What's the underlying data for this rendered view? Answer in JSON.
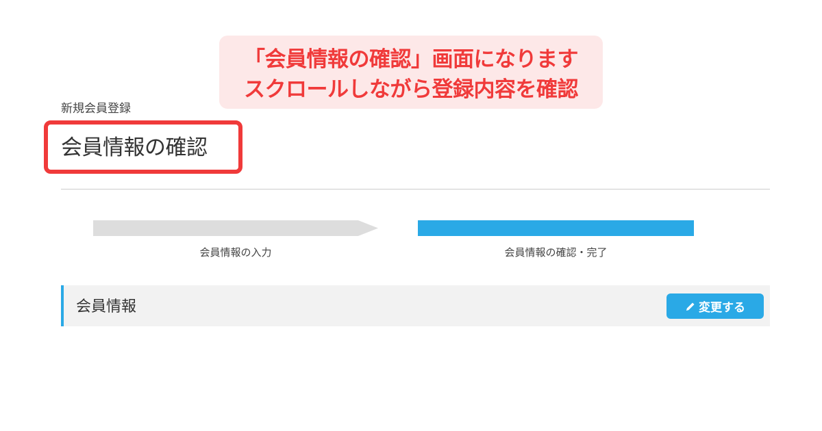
{
  "callout": {
    "line1": "「会員情報の確認」画面になります",
    "line2": "スクロールしながら登録内容を確認"
  },
  "breadcrumb": "新規会員登録",
  "page_title": "会員情報の確認",
  "steps": [
    {
      "label": "会員情報の入力",
      "active": false
    },
    {
      "label": "会員情報の確認・完了",
      "active": true
    }
  ],
  "section": {
    "title": "会員情報",
    "edit_button": {
      "label": "変更する",
      "icon": "pencil-icon"
    }
  },
  "colors": {
    "accent": "#2aa9e6",
    "highlight_red": "#f03a3a",
    "inactive_step": "#dddddd"
  }
}
